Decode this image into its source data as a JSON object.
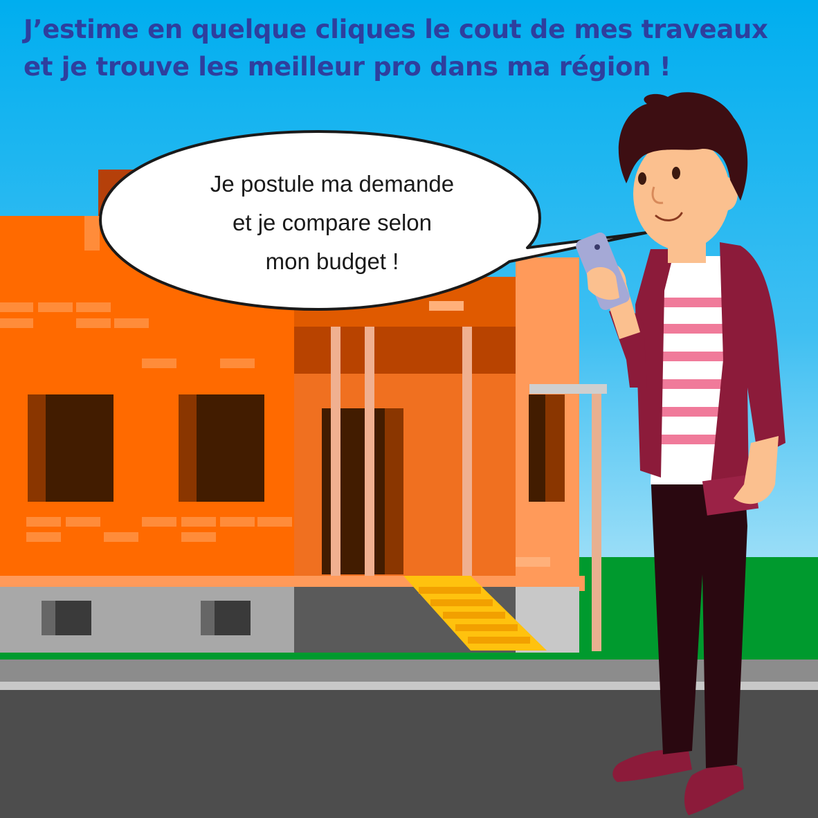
{
  "headline": {
    "line1": "J’estime en quelque cliques le cout de mes traveaux",
    "line2": "et je trouve les meilleur pro dans ma région !"
  },
  "speech_bubble": {
    "line1": "Je postule ma demande",
    "line2": "et je compare selon",
    "line3": "mon budget !"
  },
  "colors": {
    "sky_top": "#00aeef",
    "sky_bottom": "#b9e6f8",
    "headline": "#2e3f9e",
    "grass": "#009a2e",
    "road": "#4d4d4d",
    "sidewalk": "#8c8c8c",
    "wall_orange": "#ff6a00",
    "wall_light": "#ff9a55",
    "cardigan": "#8c1b3a",
    "shirt_stripes": "#f07a9a",
    "steps": "#ffc20e"
  },
  "illustration": {
    "house": "house-under-construction",
    "person": "young-man-holding-phone",
    "phone": "smartphone-icon"
  }
}
